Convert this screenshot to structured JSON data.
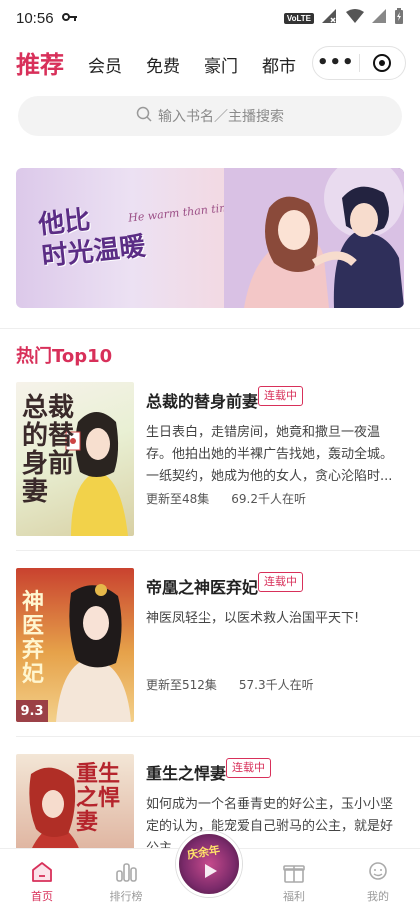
{
  "status": {
    "time": "10:56",
    "network_badge": "VoLTE"
  },
  "tabs": [
    {
      "label": "推荐",
      "active": true
    },
    {
      "label": "会员"
    },
    {
      "label": "免费"
    },
    {
      "label": "豪门"
    },
    {
      "label": "都市"
    }
  ],
  "search": {
    "placeholder": "输入书名／主播搜索"
  },
  "banner": {
    "title_line1": "他比",
    "title_line2": "时光温暖",
    "subtitle": "He warm than time"
  },
  "section": {
    "title": "热门Top10"
  },
  "books": [
    {
      "title": "总裁的替身前妻",
      "status": "连载中",
      "description": "生日表白，走错房间，她竟和撒旦一夜温存。他拍出她的半裸广告找她，轰动全城。一纸契约，她成为他的女人，贪心沦陷时...",
      "episodes": "更新至48集",
      "listeners": "69.2千人在听",
      "cover_text": "总裁的替身前妻"
    },
    {
      "title": "帝凰之神医弃妃",
      "status": "连载中",
      "description": "神医凤轻尘，以医术救人治国平天下!",
      "episodes": "更新至512集",
      "listeners": "57.3千人在听",
      "cover_text": "神医弃妃",
      "rating": "9.3"
    },
    {
      "title": "重生之悍妻",
      "status": "连载中",
      "description": "如何成为一个名垂青史的好公主，玉小小坚定的认为，能宠爱自己驸马的公主，就是好公主",
      "cover_text": "重生之悍妻"
    }
  ],
  "bottom_nav": [
    {
      "label": "首页",
      "icon": "home-icon",
      "active": true
    },
    {
      "label": "排行榜",
      "icon": "bar-chart-icon"
    },
    {
      "label": "",
      "icon": "now-playing-disc"
    },
    {
      "label": "福利",
      "icon": "gift-icon"
    },
    {
      "label": "我的",
      "icon": "user-icon"
    }
  ],
  "colors": {
    "accent": "#d8305a",
    "muted": "#9a9a9a"
  },
  "now_playing": {
    "disc_text": "庆余年"
  }
}
